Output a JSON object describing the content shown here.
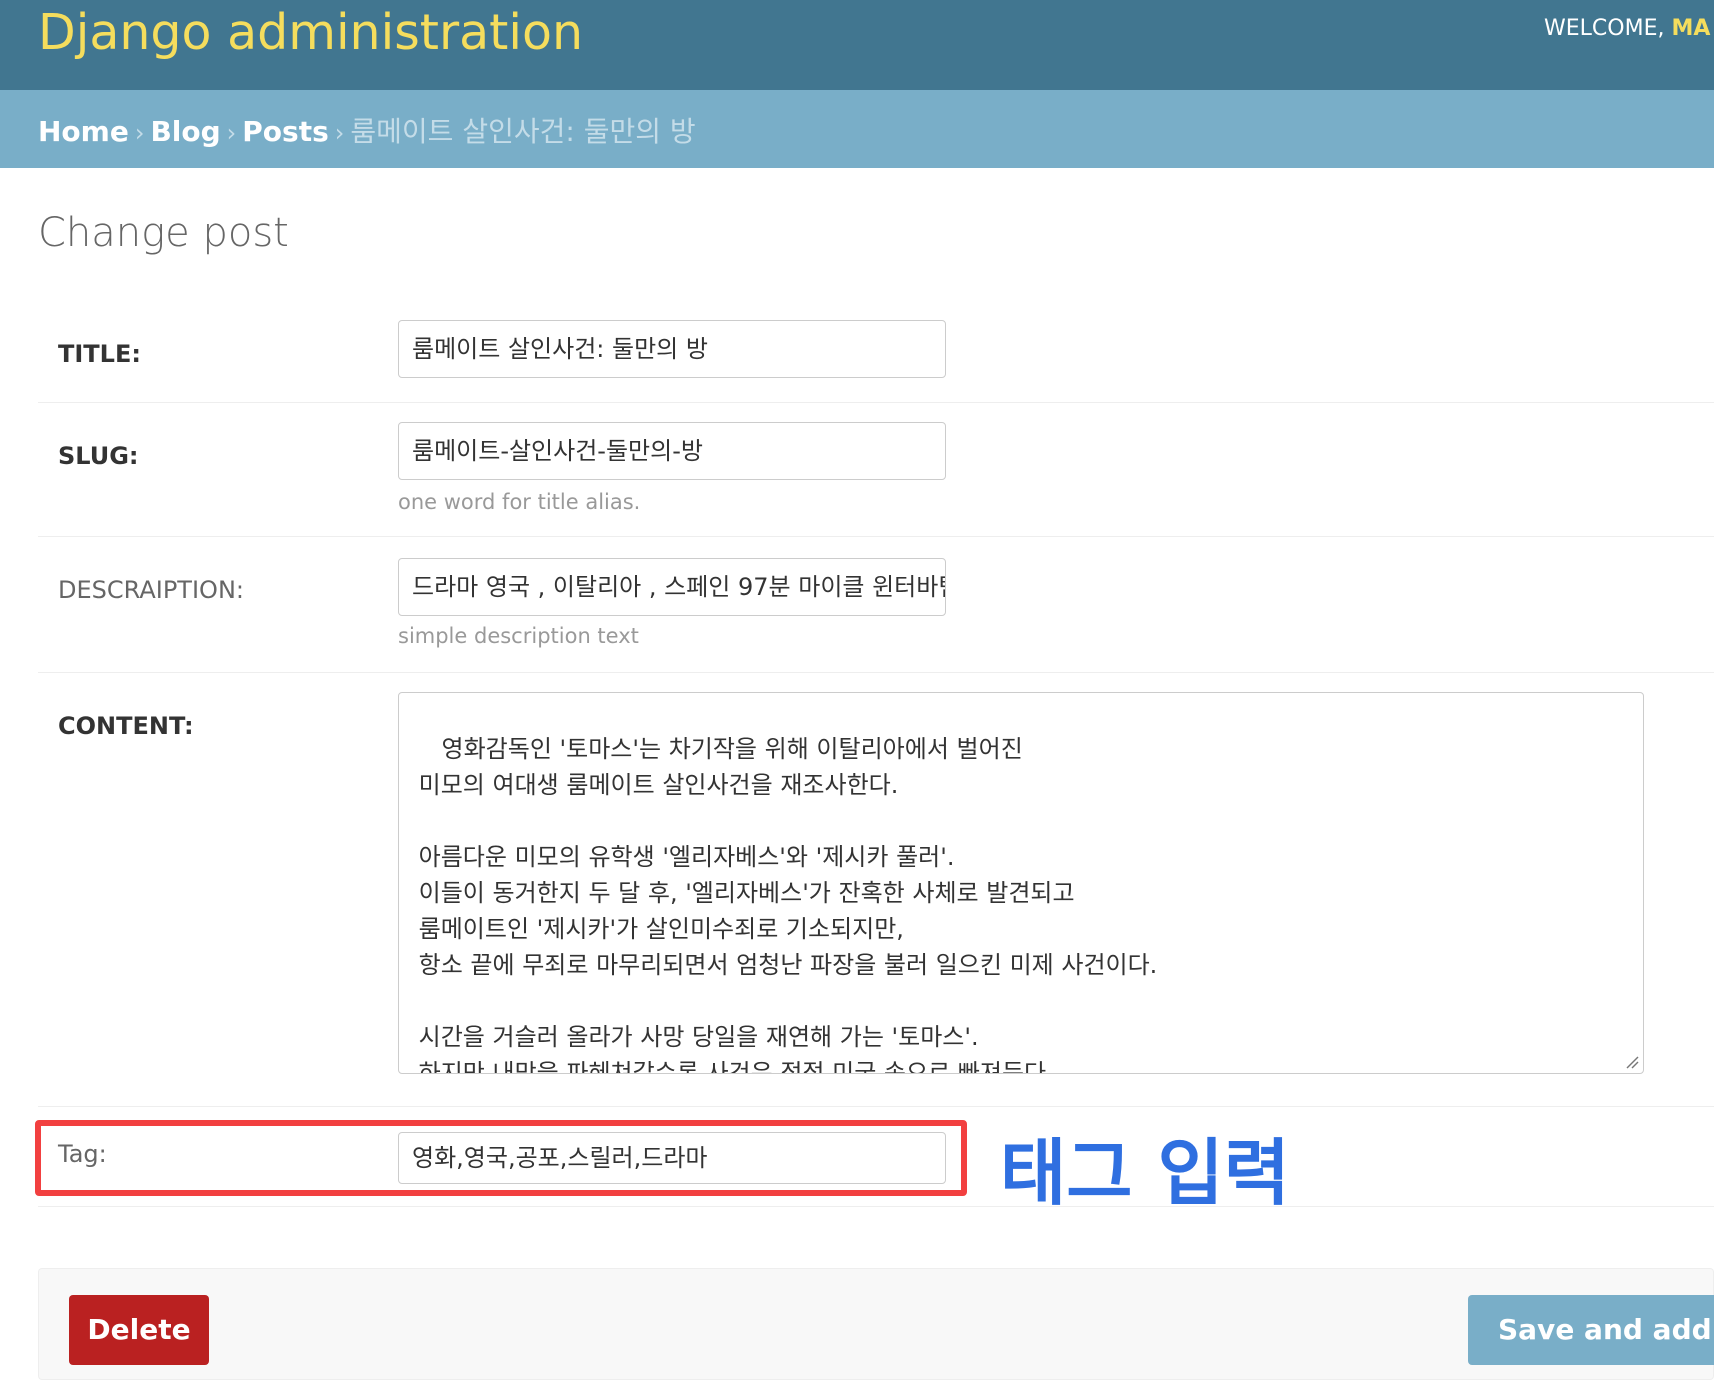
{
  "header": {
    "site_title": "Django administration",
    "welcome_text": "WELCOME, ",
    "username": "MA"
  },
  "breadcrumbs": {
    "home": "Home",
    "app": "Blog",
    "model": "Posts",
    "current": "룸메이트 살인사건: 둘만의 방",
    "separator": "›"
  },
  "page": {
    "title": "Change post"
  },
  "form": {
    "title": {
      "label": "TITLE:",
      "value": "룸메이트 살인사건: 둘만의 방"
    },
    "slug": {
      "label": "SLUG:",
      "value": "룸메이트-살인사건-둘만의-방",
      "help": "one word for title alias."
    },
    "description": {
      "label": "DESCRAIPTION:",
      "value": "드라마  영국 , 이탈리아 , 스페인  97분 마이클 윈터바텀",
      "help": "simple description text"
    },
    "content": {
      "label": "CONTENT:",
      "value": "영화감독인 '토마스'는 차기작을 위해 이탈리아에서 벌어진\n 미모의 여대생 룸메이트 살인사건을 재조사한다.\n\n 아름다운 미모의 유학생 '엘리자베스'와 '제시카 풀러'.\n 이들이 동거한지 두 달 후, '엘리자베스'가 잔혹한 사체로 발견되고\n 룸메이트인 '제시카'가 살인미수죄로 기소되지만,\n 항소 끝에 무죄로 마무리되면서 엄청난 파장을 불러 일으킨 미제 사건이다.\n\n 시간을 거슬러 올라가 사망 당일을 재연해 가는 '토마스'.\n 하지만 내막을 파헤쳐갈수록 사건은 점점 미궁 속으로 빠져든다.\n 한편, 사건 현장에서 우연히 만난 유학생 '멜라니'의 도움으로"
    },
    "tag": {
      "label": "Tag:",
      "value": "영화,영국,공포,스릴러,드라마"
    }
  },
  "annotation": {
    "text": "태그 입력",
    "color": "#2f6fe0",
    "highlight_color": "#f24040"
  },
  "submit": {
    "delete_label": "Delete",
    "save_add_label": "Save and add another"
  },
  "colors": {
    "header_bg": "#417690",
    "title_yellow": "#f5dd5d",
    "breadcrumb_bg": "#79aec8",
    "delete_red": "#ba2121"
  }
}
